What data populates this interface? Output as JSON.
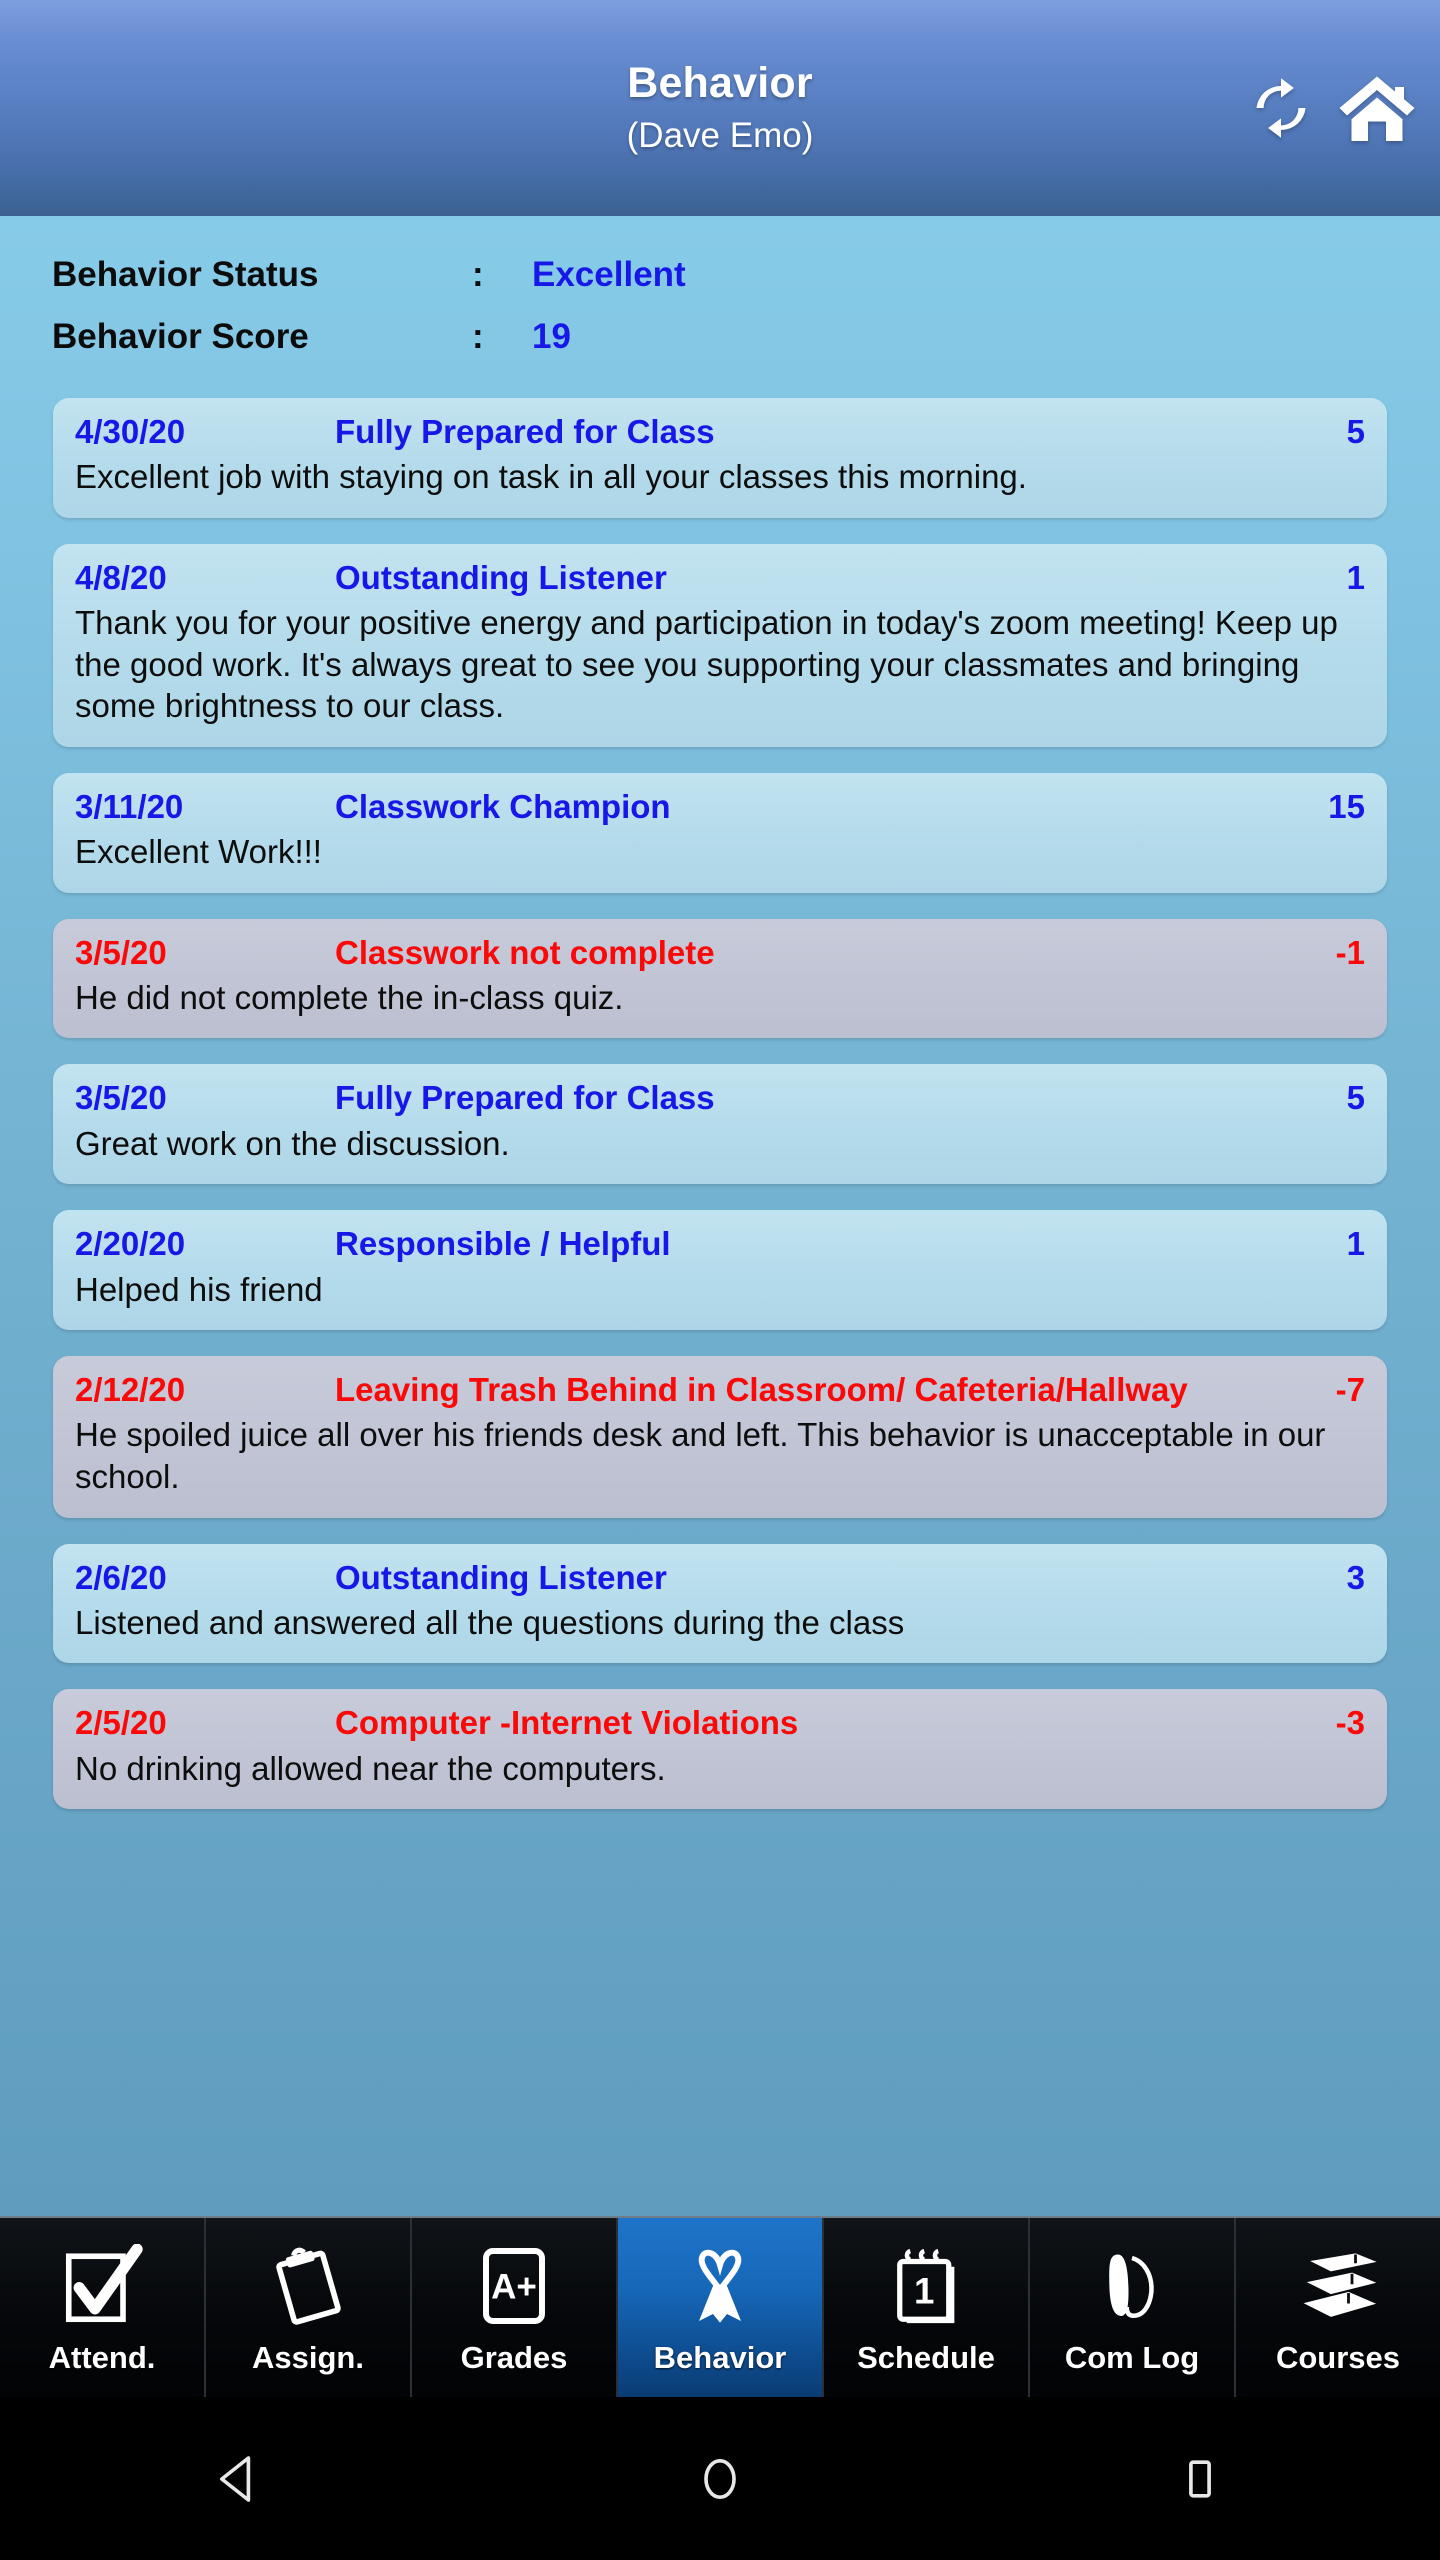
{
  "header": {
    "title": "Behavior",
    "subtitle": "(Dave Emo)",
    "refresh_icon": "refresh-icon",
    "home_icon": "home-icon"
  },
  "status": {
    "rows": [
      {
        "label": "Behavior Status",
        "colon": ":",
        "value": "Excellent"
      },
      {
        "label": "Behavior Score",
        "colon": ":",
        "value": "19"
      }
    ]
  },
  "colors": {
    "page_bg": "#7bbad8",
    "header_top": "#7d9fe0",
    "header_bottom": "#3d6290",
    "card_positive_bg": "#b7dcec",
    "card_negative_bg": "#c2c6d5",
    "positive_text": "#1717e8",
    "negative_text": "#fb0808",
    "note_text": "#0d0d0d",
    "tab_active_bg": "#1667b8",
    "tabbar_bg": "#050608"
  },
  "entries": [
    {
      "date": "4/30/20",
      "title": "Fully Prepared for Class",
      "score": "5",
      "note": "Excellent job with staying on task in all your classes this morning.",
      "type": "positive"
    },
    {
      "date": "4/8/20",
      "title": "Outstanding Listener",
      "score": "1",
      "note": "Thank you for your positive energy and participation in today's zoom meeting! Keep up the good work. It's always great to see you supporting your classmates and bringing some brightness to our class.",
      "type": "positive"
    },
    {
      "date": "3/11/20",
      "title": "Classwork Champion",
      "score": "15",
      "note": "Excellent Work!!!",
      "type": "positive"
    },
    {
      "date": "3/5/20",
      "title": "Classwork not complete",
      "score": "-1",
      "note": "He did not complete the in-class quiz.",
      "type": "negative"
    },
    {
      "date": "3/5/20",
      "title": "Fully Prepared for Class",
      "score": "5",
      "note": "Great work on the discussion.",
      "type": "positive"
    },
    {
      "date": "2/20/20",
      "title": "Responsible / Helpful",
      "score": "1",
      "note": "Helped his friend",
      "type": "positive"
    },
    {
      "date": "2/12/20",
      "title": "Leaving Trash Behind in Classroom/ Cafeteria/Hallway",
      "score": "-7",
      "note": "He spoiled juice all over his friends desk and left. This behavior is unacceptable in our school.",
      "type": "negative"
    },
    {
      "date": "2/6/20",
      "title": "Outstanding Listener",
      "score": "3",
      "note": "Listened and answered all the questions during the class",
      "type": "positive"
    },
    {
      "date": "2/5/20",
      "title": "Computer -Internet Violations",
      "score": "-3",
      "note": "No drinking allowed near the computers.",
      "type": "negative"
    }
  ],
  "tabbar": {
    "items": [
      {
        "label": "Attend.",
        "icon": "checkbox-check-icon",
        "active": false
      },
      {
        "label": "Assign.",
        "icon": "clipboard-icon",
        "active": false
      },
      {
        "label": "Grades",
        "icon": "a-plus-card-icon",
        "active": false
      },
      {
        "label": "Behavior",
        "icon": "ribbon-icon",
        "active": true
      },
      {
        "label": "Schedule",
        "icon": "calendar-notepad-icon",
        "active": false
      },
      {
        "label": "Com Log",
        "icon": "phone-handset-icon",
        "active": false
      },
      {
        "label": "Courses",
        "icon": "books-stack-icon",
        "active": false
      }
    ]
  },
  "sysnav": {
    "back": "back-triangle-icon",
    "home": "home-circle-icon",
    "recents": "recents-square-icon"
  }
}
